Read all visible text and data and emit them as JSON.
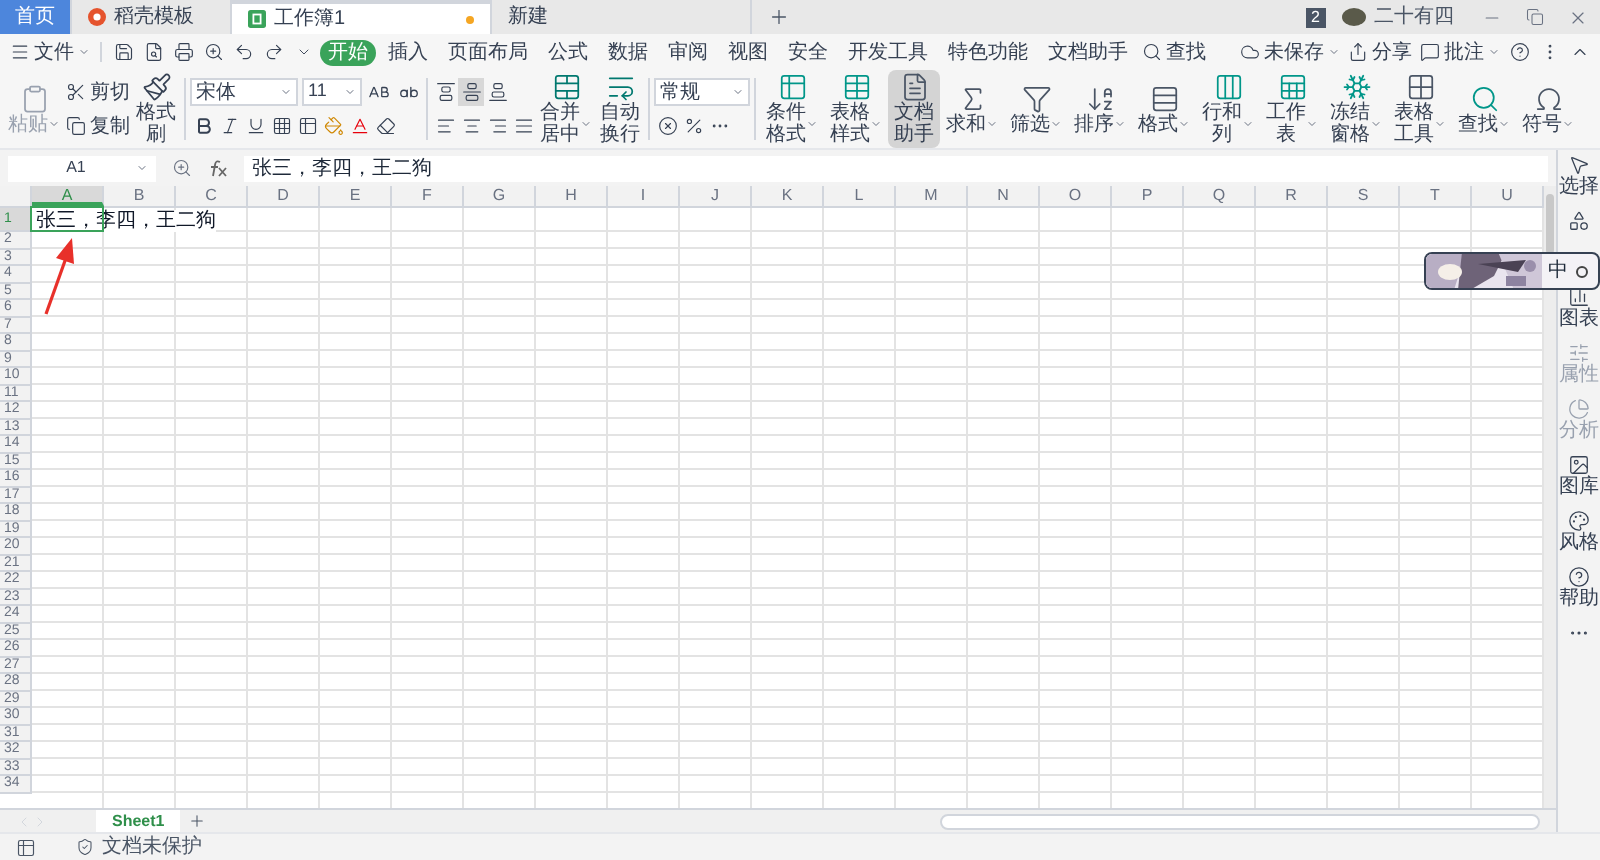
{
  "doc_tabs": [
    {
      "label": "首页",
      "kind": "home",
      "selected": false
    },
    {
      "label": "稻壳模板",
      "kind": "template",
      "selected": false
    },
    {
      "label": "工作簿1",
      "kind": "workbook",
      "selected": true,
      "modified": true
    },
    {
      "label": "新建",
      "kind": "new",
      "selected": false
    }
  ],
  "window": {
    "badge": "2",
    "user": "二十有四"
  },
  "menu": {
    "file": "文件",
    "tabs": [
      {
        "label": "开始",
        "selected": true
      },
      {
        "label": "插入",
        "selected": false
      },
      {
        "label": "页面布局",
        "selected": false
      },
      {
        "label": "公式",
        "selected": false
      },
      {
        "label": "数据",
        "selected": false
      },
      {
        "label": "审阅",
        "selected": false
      },
      {
        "label": "视图",
        "selected": false
      },
      {
        "label": "安全",
        "selected": false
      },
      {
        "label": "开发工具",
        "selected": false
      },
      {
        "label": "特色功能",
        "selected": false
      },
      {
        "label": "文档助手",
        "selected": false
      }
    ],
    "search": "查找",
    "save_status": "未保存",
    "share": "分享",
    "comment": "批注"
  },
  "ribbon": {
    "paste": {
      "label": "粘贴",
      "disabled": true
    },
    "cut": "剪切",
    "copy": "复制",
    "format_painter": "格式刷",
    "font": {
      "family": "宋体",
      "size": "11"
    },
    "merge": "合并居中",
    "wrap": "自动换行",
    "number_format": "常规",
    "tools": [
      {
        "kind": "conditional-format",
        "label": "条件格式",
        "selected": false
      },
      {
        "kind": "table-style",
        "label": "表格样式",
        "selected": false
      },
      {
        "kind": "doc-assistant",
        "label": "文档助手",
        "selected": true
      },
      {
        "kind": "sum",
        "label": "求和",
        "selected": false
      },
      {
        "kind": "filter",
        "label": "筛选",
        "selected": false
      },
      {
        "kind": "sort",
        "label": "排序",
        "selected": false
      },
      {
        "kind": "format",
        "label": "格式",
        "selected": false
      },
      {
        "kind": "rows-cols",
        "label": "行和列",
        "selected": false
      },
      {
        "kind": "sheet",
        "label": "工作表",
        "selected": false
      },
      {
        "kind": "freeze",
        "label": "冻结窗格",
        "selected": false
      },
      {
        "kind": "table-tools",
        "label": "表格工具",
        "selected": false
      },
      {
        "kind": "find",
        "label": "查找",
        "selected": false
      },
      {
        "kind": "symbol",
        "label": "符号",
        "selected": false
      }
    ]
  },
  "formula_bar": {
    "cell_name": "A1",
    "value": "张三，李四，王二狗"
  },
  "grid": {
    "columns": [
      {
        "label": "A",
        "selected": true
      },
      {
        "label": "B",
        "selected": false
      },
      {
        "label": "C",
        "selected": false
      },
      {
        "label": "D",
        "selected": false
      },
      {
        "label": "E",
        "selected": false
      },
      {
        "label": "F",
        "selected": false
      },
      {
        "label": "G",
        "selected": false
      },
      {
        "label": "H",
        "selected": false
      },
      {
        "label": "I",
        "selected": false
      },
      {
        "label": "J",
        "selected": false
      },
      {
        "label": "K",
        "selected": false
      },
      {
        "label": "L",
        "selected": false
      },
      {
        "label": "M",
        "selected": false
      },
      {
        "label": "N",
        "selected": false
      },
      {
        "label": "O",
        "selected": false
      },
      {
        "label": "P",
        "selected": false
      },
      {
        "label": "Q",
        "selected": false
      },
      {
        "label": "R",
        "selected": false
      },
      {
        "label": "S",
        "selected": false
      },
      {
        "label": "T",
        "selected": false
      },
      {
        "label": "U",
        "selected": false
      }
    ],
    "rows": [
      {
        "label": "1",
        "selected": true,
        "value": "张三，李四，王二狗"
      },
      {
        "label": "2",
        "selected": false
      },
      {
        "label": "3",
        "selected": false
      },
      {
        "label": "4",
        "selected": false
      },
      {
        "label": "5",
        "selected": false
      },
      {
        "label": "6",
        "selected": false
      },
      {
        "label": "7",
        "selected": false
      },
      {
        "label": "8",
        "selected": false
      },
      {
        "label": "9",
        "selected": false
      },
      {
        "label": "10",
        "selected": false
      },
      {
        "label": "11",
        "selected": false
      },
      {
        "label": "12",
        "selected": false
      },
      {
        "label": "13",
        "selected": false
      },
      {
        "label": "14",
        "selected": false
      },
      {
        "label": "15",
        "selected": false
      },
      {
        "label": "16",
        "selected": false
      },
      {
        "label": "17",
        "selected": false
      },
      {
        "label": "18",
        "selected": false
      },
      {
        "label": "19",
        "selected": false
      },
      {
        "label": "20",
        "selected": false
      },
      {
        "label": "21",
        "selected": false
      },
      {
        "label": "22",
        "selected": false
      },
      {
        "label": "23",
        "selected": false
      },
      {
        "label": "24",
        "selected": false
      },
      {
        "label": "25",
        "selected": false
      },
      {
        "label": "26",
        "selected": false
      },
      {
        "label": "27",
        "selected": false
      },
      {
        "label": "28",
        "selected": false
      },
      {
        "label": "29",
        "selected": false
      },
      {
        "label": "30",
        "selected": false
      },
      {
        "label": "31",
        "selected": false
      },
      {
        "label": "32",
        "selected": false
      },
      {
        "label": "33",
        "selected": false
      },
      {
        "label": "34",
        "selected": false
      }
    ]
  },
  "sidebar": [
    {
      "kind": "select",
      "label": "选择",
      "disabled": false
    },
    {
      "kind": "shape",
      "disabled": false
    },
    {
      "kind": "chart",
      "label": "图表",
      "disabled": false
    },
    {
      "kind": "property",
      "label": "属性",
      "disabled": true
    },
    {
      "kind": "analysis",
      "label": "分析",
      "disabled": true
    },
    {
      "kind": "gallery",
      "label": "图库",
      "disabled": false
    },
    {
      "kind": "style",
      "label": "风格",
      "disabled": false
    },
    {
      "kind": "help",
      "label": "帮助",
      "disabled": false
    },
    {
      "kind": "more",
      "disabled": false
    }
  ],
  "sheets": [
    {
      "label": "Sheet1",
      "selected": true
    }
  ],
  "status_bar": {
    "protection": "文档未保护"
  },
  "ime_toolbar": {
    "mode": "中",
    "kind": "picture"
  },
  "annotations": [
    {
      "kind": "arrow",
      "color": "#e8302a"
    }
  ]
}
